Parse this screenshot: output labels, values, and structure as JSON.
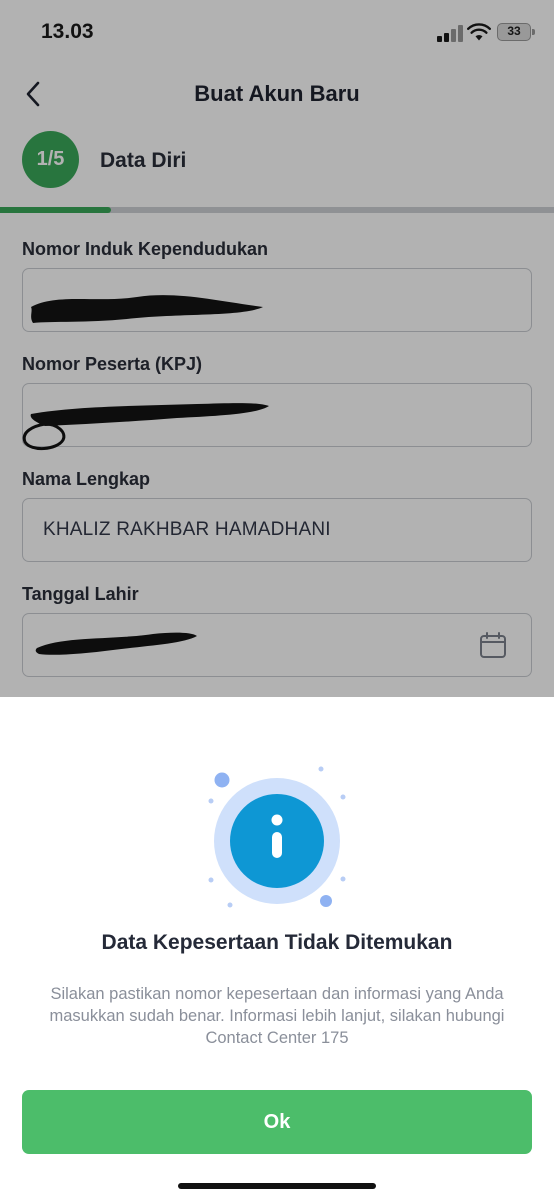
{
  "status_bar": {
    "time": "13.03",
    "battery": "33"
  },
  "nav": {
    "title": "Buat Akun Baru"
  },
  "stepper": {
    "step": "1/5",
    "label": "Data Diri",
    "progress": 0.2
  },
  "form": {
    "fields": [
      {
        "label": "Nomor Induk Kependudukan",
        "value": ""
      },
      {
        "label": "Nomor Peserta (KPJ)",
        "value": ""
      },
      {
        "label": "Nama Lengkap",
        "value": "KHALIZ RAKHBAR HAMADHANI"
      },
      {
        "label": "Tanggal Lahir",
        "value": ""
      }
    ]
  },
  "dialog": {
    "icon": "info-icon",
    "title": "Data Kepesertaan Tidak Ditemukan",
    "message": "Silakan pastikan nomor kepesertaan dan informasi yang Anda masukkan sudah benar. Informasi lebih lanjut, silakan hubungi Contact Center 175",
    "ok_label": "Ok"
  },
  "colors": {
    "accent": "#3aa85a",
    "ok_button": "#4cbd6a",
    "info_blue": "#0e97d4"
  }
}
